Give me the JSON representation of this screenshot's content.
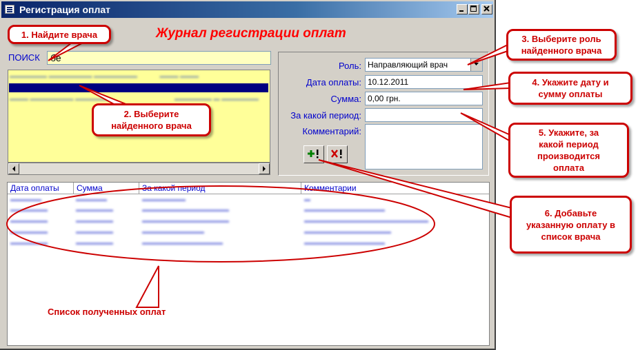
{
  "window": {
    "title": "Регистрация оплат",
    "controls": {
      "minimize": "_",
      "maximize": "□",
      "close": "✕"
    }
  },
  "header": {
    "title": "Журнал регистрации оплат"
  },
  "search": {
    "label": "ПОИСК",
    "value": "бе"
  },
  "form": {
    "role_label": "Роль:",
    "role_value": "Направляющий врач",
    "date_label": "Дата оплаты:",
    "date_value": "10.12.2011",
    "sum_label": "Сумма:",
    "sum_value": "0,00 грн.",
    "period_label": "За какой период:",
    "period_value": "",
    "comment_label": "Комментарий:",
    "comment_value": "",
    "add_button_icon": "plus-exclamation-icon",
    "delete_button_icon": "x-exclamation-icon"
  },
  "table": {
    "columns": [
      "Дата оплаты",
      "Сумма",
      "За какой период",
      "Комментарии"
    ]
  },
  "callouts": {
    "c1": "1. Найдите врача",
    "c2": "2. Выберите\nнайденного врача",
    "c3": "3. Выберите роль\nнайденного врача",
    "c4": "4. Укажите дату и\nсумму оплаты",
    "c5": "5. Укажите, за\nкакой период\nпроизводится\nоплата",
    "c6": "6. Добавьте\nуказанную оплату в\nсписок врача",
    "list_caption": "Список полученных оплат"
  },
  "colors": {
    "title_bar": "#0a246a",
    "accent_red": "#cc0000",
    "label_blue": "#0000cc",
    "search_bg": "#ffffc0",
    "list_bg": "#ffff99"
  }
}
